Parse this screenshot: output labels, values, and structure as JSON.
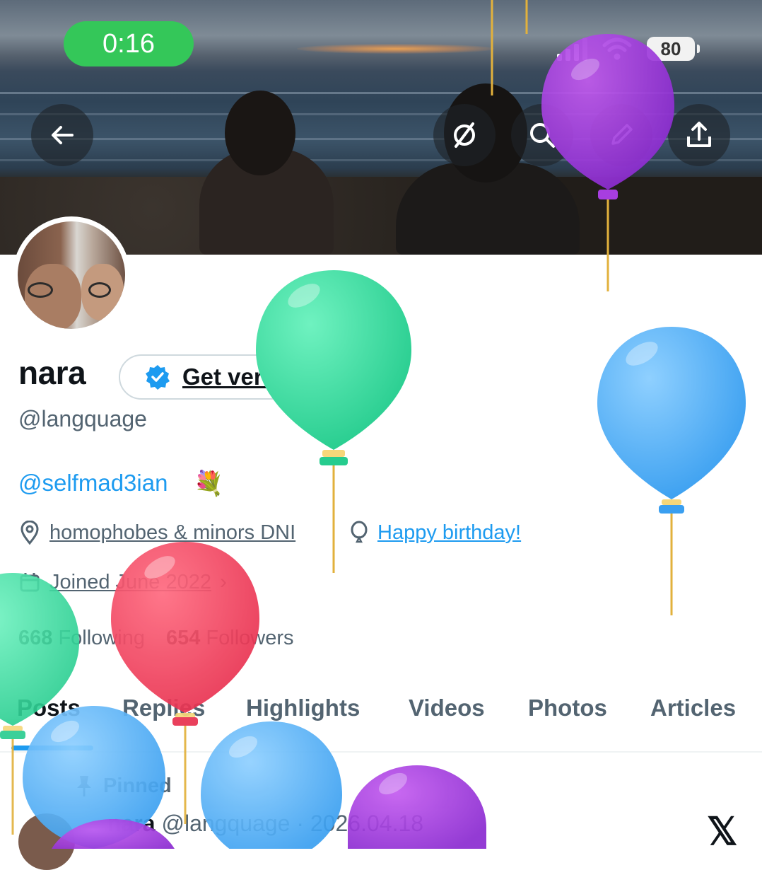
{
  "status_bar": {
    "time": "0:16",
    "battery": "80"
  },
  "header_buttons": {
    "back_icon": "arrow-left-icon",
    "grok_icon": "slash-circle-icon",
    "search_icon": "search-icon",
    "edit_icon": "pencil-icon",
    "share_icon": "share-icon"
  },
  "profile": {
    "name": "nara",
    "verify_label": "Get verified",
    "handle": "@langquage",
    "bio_link": "@selfmad3ian",
    "bio_emoji": "💐",
    "location": "homophobes & minors DNI",
    "birthday": "Happy birthday!",
    "joined": "Joined June 2022",
    "following_count": "668",
    "following_label": "Following",
    "followers_count": "654",
    "followers_label": "Followers"
  },
  "tabs": [
    "Posts",
    "Replies",
    "Highlights",
    "Videos",
    "Photos",
    "Articles"
  ],
  "active_tab": "Posts",
  "pinned": {
    "label": "Pinned",
    "author": "nara",
    "handle": "@langquage",
    "date": "· 2026.04.18",
    "logo": "𝕏"
  },
  "colors": {
    "accent": "#1d9bf0",
    "text": "#0f1419",
    "muted": "#536471",
    "status_green": "#34c759"
  }
}
